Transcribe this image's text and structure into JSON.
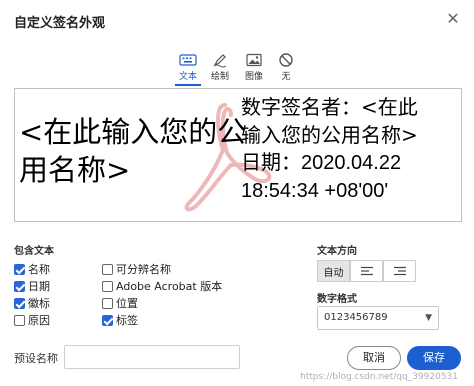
{
  "dialog": {
    "title": "自定义签名外观",
    "close_glyph": "✕"
  },
  "tabs": [
    {
      "label": "文本",
      "icon": "keyboard-icon",
      "active": true
    },
    {
      "label": "绘制",
      "icon": "pen-icon",
      "active": false
    },
    {
      "label": "图像",
      "icon": "image-icon",
      "active": false
    },
    {
      "label": "无",
      "icon": "none-icon",
      "active": false
    }
  ],
  "preview": {
    "name_text": "<在此输入您的公用名称>",
    "signer_line1": "数字签名者：<在此",
    "signer_line2": "输入您的公用名称>",
    "date_line1": "日期：2020.04.22",
    "date_line2": "18:54:34 +08'00'",
    "watermark_color": "#e8a0a0"
  },
  "include_text": {
    "label": "包含文本",
    "options": [
      {
        "label": "名称",
        "checked": true
      },
      {
        "label": "日期",
        "checked": true
      },
      {
        "label": "徽标",
        "checked": true
      },
      {
        "label": "原因",
        "checked": false
      },
      {
        "label": "可分辨名称",
        "checked": false
      },
      {
        "label": "Adobe Acrobat 版本",
        "checked": false
      },
      {
        "label": "位置",
        "checked": false
      },
      {
        "label": "标签",
        "checked": true
      }
    ]
  },
  "text_direction": {
    "label": "文本方向",
    "auto_label": "自动",
    "selected": "自动"
  },
  "digit_format": {
    "label": "数字格式",
    "value": "0123456789"
  },
  "preset_name": {
    "label": "预设名称",
    "value": ""
  },
  "buttons": {
    "cancel": "取消",
    "save": "保存"
  },
  "footer_url": "https://blog.csdn.net/qq_39920531",
  "colors": {
    "accent": "#1d5fd1",
    "checkbox_on": "#2a64d6"
  }
}
